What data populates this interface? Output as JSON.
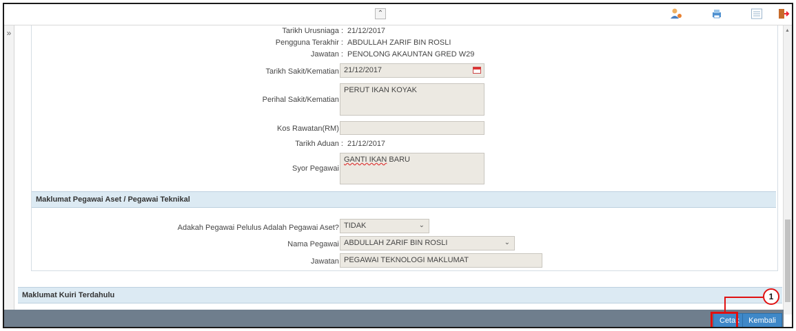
{
  "toolbar": {
    "collapse_glyph": "≈",
    "icons": [
      "user-icon",
      "print-icon",
      "list-icon",
      "logout-icon"
    ]
  },
  "sidebar": {
    "expand_glyph": "»"
  },
  "detail": {
    "tarikh_urusniaga": {
      "label": "Tarikh Urusniaga :",
      "value": "21/12/2017"
    },
    "pengguna_terakhir": {
      "label": "Pengguna Terakhir :",
      "value": "ABDULLAH ZARIF BIN ROSLI"
    },
    "jawatan": {
      "label": "Jawatan :",
      "value": "PENOLONG AKAUNTAN GRED W29"
    },
    "tarikh_sakit": {
      "label": "Tarikh Sakit/Kematian :",
      "value": "21/12/2017"
    },
    "perihal_sakit": {
      "label": "Perihal Sakit/Kematian :",
      "value": "PERUT IKAN KOYAK"
    },
    "kos_rawatan": {
      "label": "Kos Rawatan(RM) :",
      "value": ""
    },
    "tarikh_aduan": {
      "label": "Tarikh Aduan :",
      "value": "21/12/2017"
    },
    "syor_pegawai": {
      "label": "Syor Pegawai :",
      "value_part1": "GANTI IKAN",
      "value_part2": " BARU"
    }
  },
  "section_aset": {
    "title": "Maklumat Pegawai Aset / Pegawai Teknikal",
    "adakah": {
      "label": "Adakah Pegawai Pelulus Adalah Pegawai Aset? :",
      "value": "TIDAK"
    },
    "nama_pegawai": {
      "label": "Nama Pegawai :",
      "value": "ABDULLAH ZARIF BIN ROSLI"
    },
    "jawatan": {
      "label": "Jawatan :",
      "value": "PEGAWAI TEKNOLOGI MAKLUMAT"
    }
  },
  "section_kuiri": {
    "title": "Maklumat Kuiri Terdahulu"
  },
  "footer": {
    "cetak_label": "Cetak",
    "kembali_label": "Kembali"
  },
  "callout": {
    "number": "1"
  },
  "colors": {
    "header_bg": "#dceaf3",
    "footer_bg": "#6f7e8d",
    "button_bg": "#3f88c8",
    "highlight": "#e01010"
  }
}
